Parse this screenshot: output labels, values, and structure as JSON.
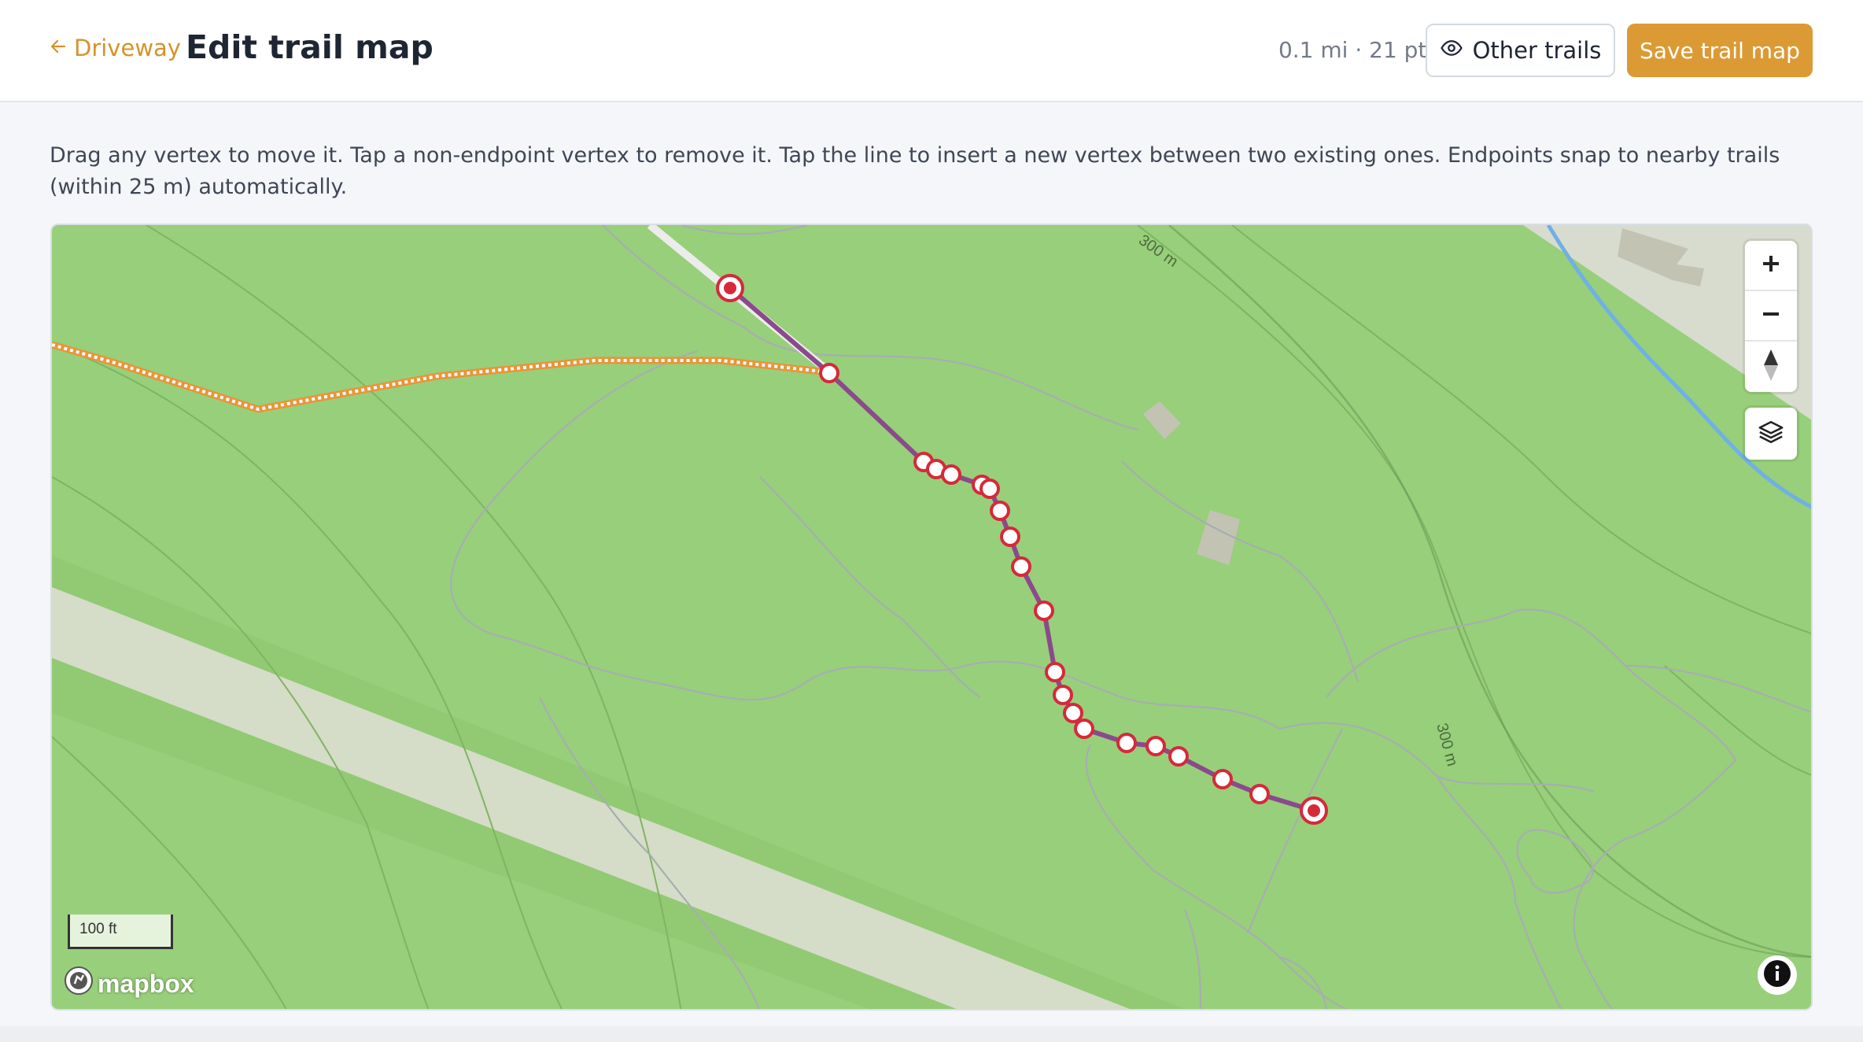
{
  "header": {
    "back_label": "Driveway",
    "title": "Edit trail map",
    "stats": "0.1 mi · 21 pts",
    "other_trails_label": "Other trails",
    "save_label": "Save trail map"
  },
  "instructions": "Drag any vertex to move it. Tap a non-endpoint vertex to remove it. Tap the line to insert a new vertex between two existing ones. Endpoints snap to nearby trails (within 25 m) automatically.",
  "map": {
    "scale_label": "100 ft",
    "contour_label_top": "300 m",
    "contour_label_right": "300 m",
    "attribution_logo": "mapbox",
    "controls": [
      "zoom-in",
      "zoom-out",
      "compass",
      "layers",
      "info"
    ],
    "colors": {
      "terrain": "#98cf7a",
      "trail_edit": "#8a4a8c",
      "vertex_stroke": "#d6293a",
      "other_trail": "#e8953a",
      "stream": "#6fb0e6",
      "road": "#d5dcc8",
      "accent": "#dc9a34"
    }
  }
}
